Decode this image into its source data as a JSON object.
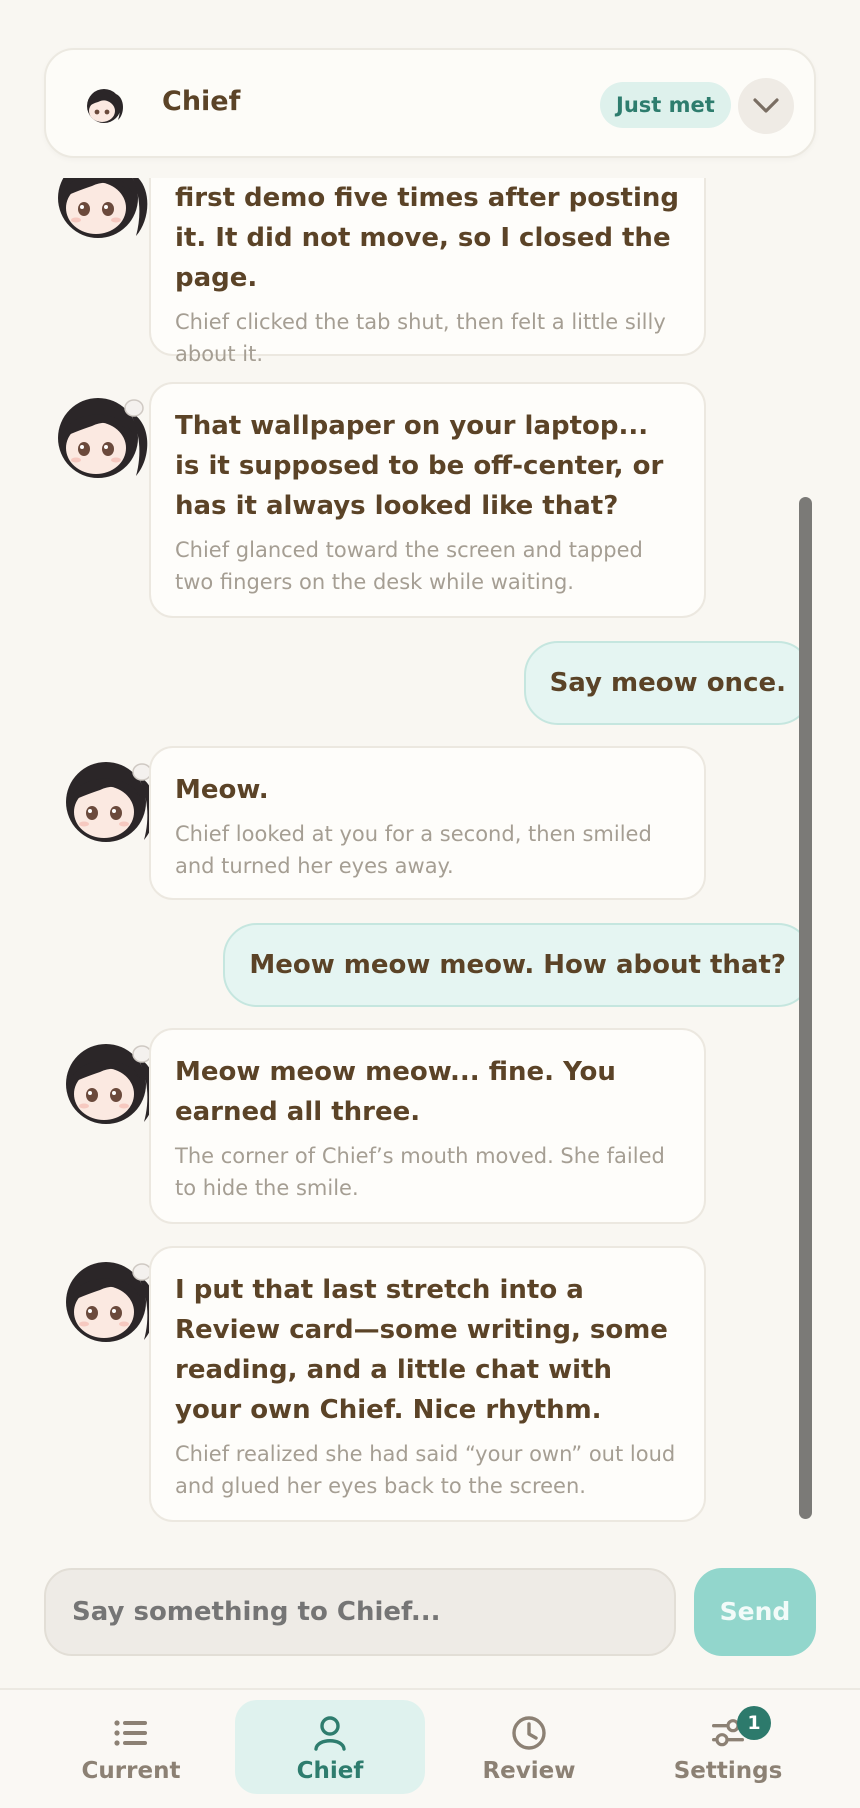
{
  "header": {
    "title": "Chief",
    "status_badge": "Just met"
  },
  "messages": [
    {
      "from": "chief",
      "text": "first demo five times after posting it. It did not move, so I closed the page.",
      "note": "Chief clicked the tab shut, then felt a little silly about it."
    },
    {
      "from": "chief",
      "text": "That wallpaper on your laptop... is it supposed to be off-center, or has it always looked like that?",
      "note": "Chief glanced toward the screen and tapped two fingers on the desk while waiting."
    },
    {
      "from": "user",
      "text": "Say meow once."
    },
    {
      "from": "chief",
      "text": "Meow.",
      "note": "Chief looked at you for a second, then smiled and turned her eyes away."
    },
    {
      "from": "user",
      "text": "Meow meow meow. How about that?"
    },
    {
      "from": "chief",
      "text": "Meow meow meow... fine. You earned all three.",
      "note": "The corner of Chief’s mouth moved. She failed to hide the smile."
    },
    {
      "from": "chief",
      "text": "I put that last stretch into a Review card—some writing, some reading, and a little chat with your own Chief. Nice rhythm.",
      "note": "Chief realized she had said “your own” out loud and glued her eyes back to the screen."
    }
  ],
  "composer": {
    "placeholder": "Say something to Chief...",
    "send_label": "Send"
  },
  "nav": {
    "items": [
      {
        "label": "Current",
        "icon": "list-icon"
      },
      {
        "label": "Chief",
        "icon": "person-icon",
        "active": true
      },
      {
        "label": "Review",
        "icon": "clock-icon"
      },
      {
        "label": "Settings",
        "icon": "sliders-icon",
        "badge": "1"
      }
    ]
  },
  "colors": {
    "accent": "#2e7d6e",
    "send_button": "#92d6cc",
    "user_bubble": "#e5f5f2"
  }
}
